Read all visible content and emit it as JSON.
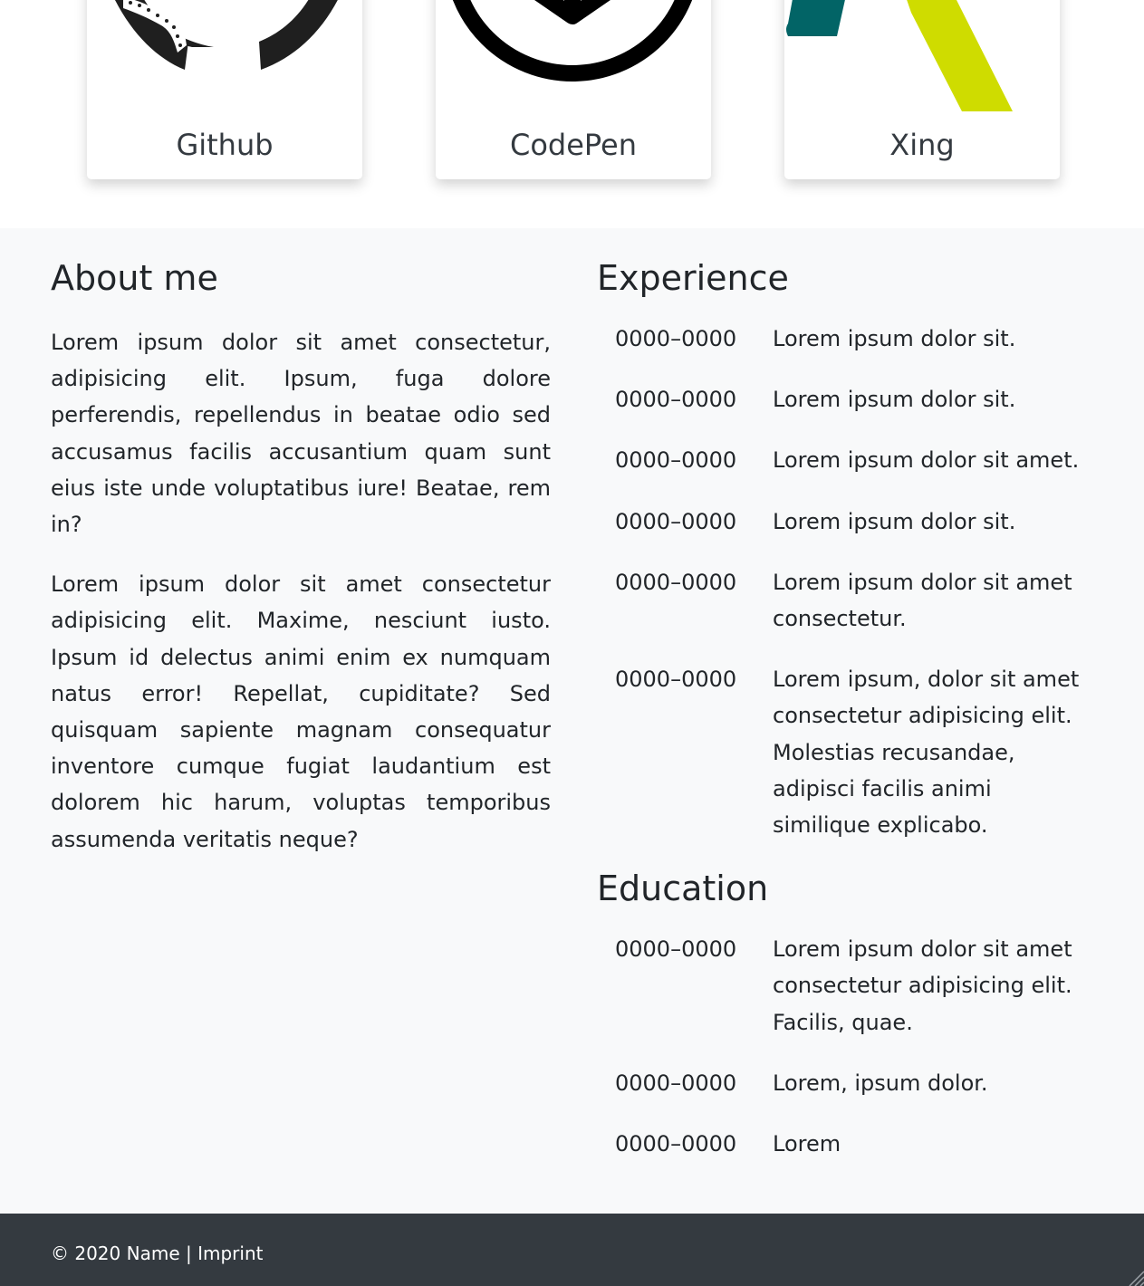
{
  "cards": [
    {
      "label": "Github",
      "icon": "github-octocat-icon"
    },
    {
      "label": "CodePen",
      "icon": "codepen-icon"
    },
    {
      "label": "Xing",
      "icon": "xing-icon"
    }
  ],
  "colors": {
    "page_bg": "#ffffff",
    "section_bg": "#f8f9fa",
    "footer_bg": "#343a40",
    "xing_teal": "#026466",
    "xing_lime": "#cfdc00"
  },
  "about": {
    "heading": "About me",
    "paragraphs": [
      "Lorem ipsum dolor sit amet consectetur, adipisicing elit. Ipsum, fuga dolore perferendis, repellendus in beatae odio sed accusamus facilis accusantium quam sunt eius iste unde voluptatibus iure! Beatae, rem in?",
      "Lorem ipsum dolor sit amet consectetur adipisicing elit. Maxime, nesciunt iusto. Ipsum id delectus animi enim ex numquam natus error! Repellat, cupiditate? Sed quisquam sapiente magnam consequatur inventore cumque fugiat laudantium est dolorem hic harum, voluptas temporibus assumenda veritatis neque?"
    ]
  },
  "experience": {
    "heading": "Experience",
    "items": [
      {
        "date": "0000–0000",
        "text": "Lorem ipsum dolor sit."
      },
      {
        "date": "0000–0000",
        "text": "Lorem ipsum dolor sit."
      },
      {
        "date": "0000–0000",
        "text": "Lorem ipsum dolor sit amet."
      },
      {
        "date": "0000–0000",
        "text": "Lorem ipsum dolor sit."
      },
      {
        "date": "0000–0000",
        "text": "Lorem ipsum dolor sit amet consectetur."
      },
      {
        "date": "0000–0000",
        "text": "Lorem ipsum, dolor sit amet consectetur adipisicing elit. Molestias recusandae, adipisci facilis animi similique explicabo."
      }
    ]
  },
  "education": {
    "heading": "Education",
    "items": [
      {
        "date": "0000–0000",
        "text": "Lorem ipsum dolor sit amet consectetur adipisicing elit. Facilis, quae."
      },
      {
        "date": "0000–0000",
        "text": "Lorem, ipsum dolor."
      },
      {
        "date": "0000–0000",
        "text": "Lorem"
      }
    ]
  },
  "footer": {
    "copyright": "© 2020 Name",
    "separator": "|",
    "imprint_label": "Imprint"
  }
}
